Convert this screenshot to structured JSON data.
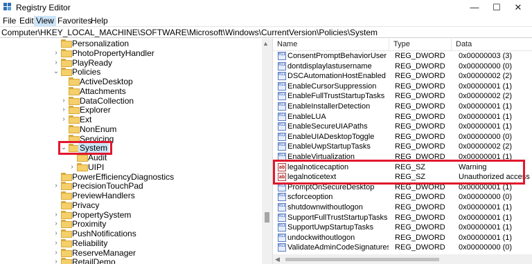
{
  "window": {
    "title": "Registry Editor",
    "minimize": "—",
    "maximize": "☐",
    "close": "✕"
  },
  "menu": [
    "File",
    "Edit",
    "View",
    "Favorites",
    "Help"
  ],
  "menu_active_index": 2,
  "address": "Computer\\HKEY_LOCAL_MACHINE\\SOFTWARE\\Microsoft\\Windows\\CurrentVersion\\Policies\\System",
  "tree": [
    {
      "label": "Personalization",
      "level": 0,
      "chevron": "",
      "selected": false
    },
    {
      "label": "PhotoPropertyHandler",
      "level": 0,
      "chevron": "›",
      "selected": false
    },
    {
      "label": "PlayReady",
      "level": 0,
      "chevron": "›",
      "selected": false
    },
    {
      "label": "Policies",
      "level": 0,
      "chevron": "⌄",
      "selected": false
    },
    {
      "label": "ActiveDesktop",
      "level": 1,
      "chevron": "",
      "selected": false
    },
    {
      "label": "Attachments",
      "level": 1,
      "chevron": "",
      "selected": false
    },
    {
      "label": "DataCollection",
      "level": 1,
      "chevron": "›",
      "selected": false
    },
    {
      "label": "Explorer",
      "level": 1,
      "chevron": "›",
      "selected": false
    },
    {
      "label": "Ext",
      "level": 1,
      "chevron": "›",
      "selected": false
    },
    {
      "label": "NonEnum",
      "level": 1,
      "chevron": "",
      "selected": false
    },
    {
      "label": "Servicing",
      "level": 1,
      "chevron": "",
      "selected": false
    },
    {
      "label": "System",
      "level": 1,
      "chevron": "⌄",
      "selected": true
    },
    {
      "label": "Audit",
      "level": 2,
      "chevron": "",
      "selected": false
    },
    {
      "label": "UIPI",
      "level": 2,
      "chevron": "›",
      "selected": false
    },
    {
      "label": "PowerEfficiencyDiagnostics",
      "level": 0,
      "chevron": "",
      "selected": false
    },
    {
      "label": "PrecisionTouchPad",
      "level": 0,
      "chevron": "›",
      "selected": false
    },
    {
      "label": "PreviewHandlers",
      "level": 0,
      "chevron": "",
      "selected": false
    },
    {
      "label": "Privacy",
      "level": 0,
      "chevron": "",
      "selected": false
    },
    {
      "label": "PropertySystem",
      "level": 0,
      "chevron": "›",
      "selected": false
    },
    {
      "label": "Proximity",
      "level": 0,
      "chevron": "›",
      "selected": false
    },
    {
      "label": "PushNotifications",
      "level": 0,
      "chevron": "›",
      "selected": false
    },
    {
      "label": "Reliability",
      "level": 0,
      "chevron": "›",
      "selected": false
    },
    {
      "label": "ReserveManager",
      "level": 0,
      "chevron": "›",
      "selected": false
    },
    {
      "label": "RetailDemo",
      "level": 0,
      "chevron": "›",
      "selected": false
    }
  ],
  "list": {
    "columns": [
      "Name",
      "Type",
      "Data"
    ],
    "rows": [
      {
        "name": "ConsentPromptBehaviorUser",
        "type": "REG_DWORD",
        "data": "0x00000003 (3)",
        "icon": "dword-icon"
      },
      {
        "name": "dontdisplaylastusername",
        "type": "REG_DWORD",
        "data": "0x00000000 (0)",
        "icon": "dword-icon"
      },
      {
        "name": "DSCAutomationHostEnabled",
        "type": "REG_DWORD",
        "data": "0x00000002 (2)",
        "icon": "dword-icon"
      },
      {
        "name": "EnableCursorSuppression",
        "type": "REG_DWORD",
        "data": "0x00000001 (1)",
        "icon": "dword-icon"
      },
      {
        "name": "EnableFullTrustStartupTasks",
        "type": "REG_DWORD",
        "data": "0x00000002 (2)",
        "icon": "dword-icon"
      },
      {
        "name": "EnableInstallerDetection",
        "type": "REG_DWORD",
        "data": "0x00000001 (1)",
        "icon": "dword-icon"
      },
      {
        "name": "EnableLUA",
        "type": "REG_DWORD",
        "data": "0x00000001 (1)",
        "icon": "dword-icon"
      },
      {
        "name": "EnableSecureUIAPaths",
        "type": "REG_DWORD",
        "data": "0x00000001 (1)",
        "icon": "dword-icon"
      },
      {
        "name": "EnableUIADesktopToggle",
        "type": "REG_DWORD",
        "data": "0x00000000 (0)",
        "icon": "dword-icon"
      },
      {
        "name": "EnableUwpStartupTasks",
        "type": "REG_DWORD",
        "data": "0x00000002 (2)",
        "icon": "dword-icon"
      },
      {
        "name": "EnableVirtualization",
        "type": "REG_DWORD",
        "data": "0x00000001 (1)",
        "icon": "dword-icon"
      },
      {
        "name": "legalnoticecaption",
        "type": "REG_SZ",
        "data": "Warning",
        "icon": "string-icon"
      },
      {
        "name": "legalnoticetext",
        "type": "REG_SZ",
        "data": "Unauthorized access to",
        "icon": "string-icon"
      },
      {
        "name": "PromptOnSecureDesktop",
        "type": "REG_DWORD",
        "data": "0x00000001 (1)",
        "icon": "dword-icon"
      },
      {
        "name": "scforceoption",
        "type": "REG_DWORD",
        "data": "0x00000000 (0)",
        "icon": "dword-icon"
      },
      {
        "name": "shutdownwithoutlogon",
        "type": "REG_DWORD",
        "data": "0x00000001 (1)",
        "icon": "dword-icon"
      },
      {
        "name": "SupportFullTrustStartupTasks",
        "type": "REG_DWORD",
        "data": "0x00000001 (1)",
        "icon": "dword-icon"
      },
      {
        "name": "SupportUwpStartupTasks",
        "type": "REG_DWORD",
        "data": "0x00000001 (1)",
        "icon": "dword-icon"
      },
      {
        "name": "undockwithoutlogon",
        "type": "REG_DWORD",
        "data": "0x00000001 (1)",
        "icon": "dword-icon"
      },
      {
        "name": "ValidateAdminCodeSignatures",
        "type": "REG_DWORD",
        "data": "0x00000000 (0)",
        "icon": "dword-icon"
      }
    ]
  },
  "icons": {
    "dword": "0110 1001",
    "string": "ab"
  },
  "colors": {
    "highlight": "#e0182d",
    "selection": "#cce4f7",
    "folder": "#f4cf6a"
  }
}
